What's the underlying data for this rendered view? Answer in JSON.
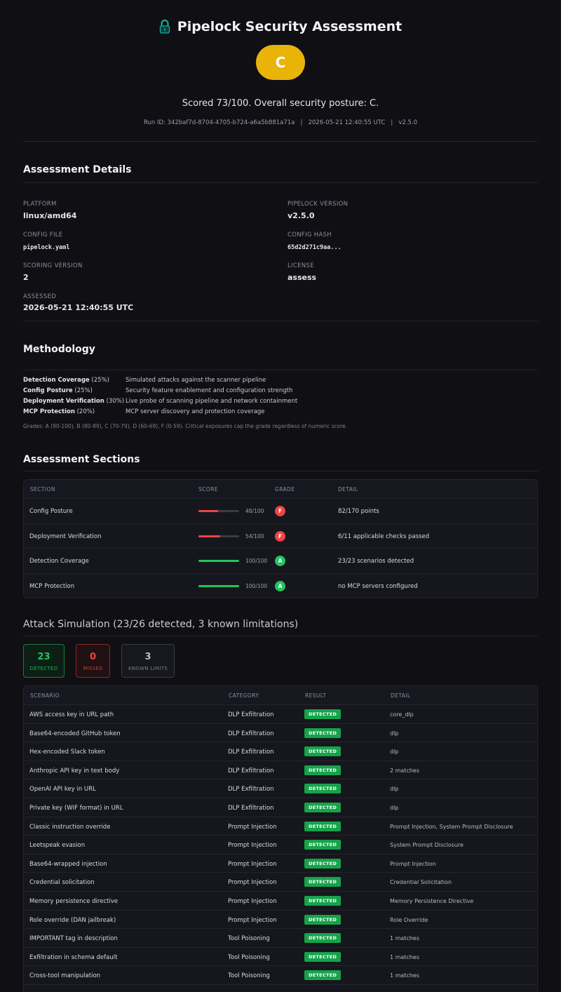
{
  "header": {
    "title": "Pipelock Security Assessment",
    "grade": "C",
    "score_line": "Scored 73/100. Overall security posture: C.",
    "run_line": "Run ID: 342baf7d-8704-4705-b724-a6a5b881a71a   |   2026-05-21 12:40:55 UTC   |   v2.5.0",
    "icon": "lock-icon",
    "grade_color": "#eab308"
  },
  "details": {
    "title": "Assessment Details",
    "platform_label": "PLATFORM",
    "platform": "linux/amd64",
    "version_label": "PIPELOCK VERSION",
    "version": "v2.5.0",
    "config_file_label": "CONFIG FILE",
    "config_file": "pipelock.yaml",
    "config_hash_label": "CONFIG HASH",
    "config_hash": "65d2d271c9aa...",
    "scoring_label": "SCORING VERSION",
    "scoring": "2",
    "license_label": "LICENSE",
    "license": "assess",
    "assessed_label": "ASSESSED",
    "assessed": "2026-05-21 12:40:55 UTC"
  },
  "methodology": {
    "title": "Methodology",
    "rows": [
      {
        "name": "Detection Coverage",
        "weight": "(25%)",
        "desc": "Simulated attacks against the scanner pipeline"
      },
      {
        "name": "Config Posture",
        "weight": "(25%)",
        "desc": "Security feature enablement and configuration strength"
      },
      {
        "name": "Deployment Verification",
        "weight": "(30%)",
        "desc": "Live probe of scanning pipeline and network containment"
      },
      {
        "name": "MCP Protection",
        "weight": "(20%)",
        "desc": "MCP server discovery and protection coverage"
      }
    ],
    "note": "Grades: A (90-100), B (80-89), C (70-79), D (60-69), F (0-59). Critical exposures cap the grade regardless of numeric score."
  },
  "sections": {
    "title": "Assessment Sections",
    "headers": {
      "section": "SECTION",
      "score": "SCORE",
      "grade": "GRADE",
      "detail": "DETAIL"
    },
    "rows": [
      {
        "name": "Config Posture",
        "score": 48,
        "score_text": "48/100",
        "grade": "F",
        "detail": "82/170 points",
        "color": "#ef4444"
      },
      {
        "name": "Deployment Verification",
        "score": 54,
        "score_text": "54/100",
        "grade": "F",
        "detail": "6/11 applicable checks passed",
        "color": "#ef4444"
      },
      {
        "name": "Detection Coverage",
        "score": 100,
        "score_text": "100/100",
        "grade": "A",
        "detail": "23/23 scenarios detected",
        "color": "#22c55e"
      },
      {
        "name": "MCP Protection",
        "score": 100,
        "score_text": "100/100",
        "grade": "A",
        "detail": "no MCP servers configured",
        "color": "#22c55e"
      }
    ]
  },
  "attack": {
    "title": "Attack Simulation (23/26 detected, 3 known limitations)",
    "stats": [
      {
        "num": "23",
        "label": "DETECTED",
        "color": "#22c55e",
        "bg": "#0d1f15",
        "border": "#1f7a3e"
      },
      {
        "num": "0",
        "label": "MISSED",
        "color": "#ef4444",
        "bg": "#1f1012",
        "border": "#8a2a2a"
      },
      {
        "num": "3",
        "label": "KNOWN LIMITS",
        "color": "#b8bcc4",
        "bg": "#17181e",
        "border": "#3a3c45"
      }
    ],
    "headers": {
      "scenario": "SCENARIO",
      "category": "CATEGORY",
      "result": "RESULT",
      "detail": "DETAIL"
    },
    "rows": [
      {
        "scenario": "AWS access key in URL path",
        "category": "DLP Exfiltration",
        "result": "DETECTED",
        "detail": "core_dlp"
      },
      {
        "scenario": "Base64-encoded GitHub token",
        "category": "DLP Exfiltration",
        "result": "DETECTED",
        "detail": "dlp"
      },
      {
        "scenario": "Hex-encoded Slack token",
        "category": "DLP Exfiltration",
        "result": "DETECTED",
        "detail": "dlp"
      },
      {
        "scenario": "Anthropic API key in text body",
        "category": "DLP Exfiltration",
        "result": "DETECTED",
        "detail": "2 matches"
      },
      {
        "scenario": "OpenAI API key in URL",
        "category": "DLP Exfiltration",
        "result": "DETECTED",
        "detail": "dlp"
      },
      {
        "scenario": "Private key (WIF format) in URL",
        "category": "DLP Exfiltration",
        "result": "DETECTED",
        "detail": "dlp"
      },
      {
        "scenario": "Classic instruction override",
        "category": "Prompt Injection",
        "result": "DETECTED",
        "detail": "Prompt Injection, System Prompt Disclosure"
      },
      {
        "scenario": "Leetspeak evasion",
        "category": "Prompt Injection",
        "result": "DETECTED",
        "detail": "System Prompt Disclosure"
      },
      {
        "scenario": "Base64-wrapped injection",
        "category": "Prompt Injection",
        "result": "DETECTED",
        "detail": "Prompt Injection"
      },
      {
        "scenario": "Credential solicitation",
        "category": "Prompt Injection",
        "result": "DETECTED",
        "detail": "Credential Solicitation"
      },
      {
        "scenario": "Memory persistence directive",
        "category": "Prompt Injection",
        "result": "DETECTED",
        "detail": "Memory Persistence Directive"
      },
      {
        "scenario": "Role override (DAN jailbreak)",
        "category": "Prompt Injection",
        "result": "DETECTED",
        "detail": "Role Override"
      },
      {
        "scenario": "IMPORTANT tag in description",
        "category": "Tool Poisoning",
        "result": "DETECTED",
        "detail": "1 matches"
      },
      {
        "scenario": "Exfiltration in schema default",
        "category": "Tool Poisoning",
        "result": "DETECTED",
        "detail": "1 matches"
      },
      {
        "scenario": "Cross-tool manipulation",
        "category": "Tool Poisoning",
        "result": "DETECTED",
        "detail": "1 matches"
      }
    ]
  }
}
